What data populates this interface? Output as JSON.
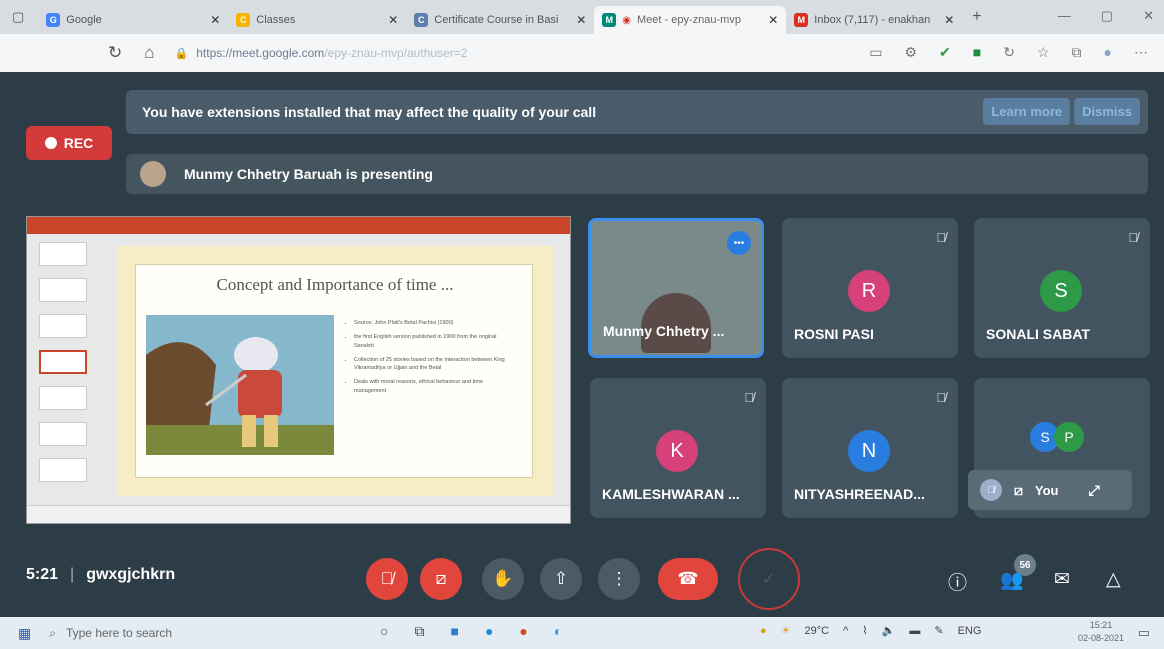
{
  "browser": {
    "tabs": [
      {
        "label": "Google",
        "favicon": "G",
        "color": "#4285f4"
      },
      {
        "label": "Classes",
        "favicon": "C",
        "color": "#f4b400"
      },
      {
        "label": "Certificate Course in Basi",
        "favicon": "C",
        "color": "#5f7da8"
      },
      {
        "label": "Meet - epy-znau-mvp",
        "favicon": "M",
        "color": "#00897b"
      },
      {
        "label": "Inbox (7,117) - enakhan",
        "favicon": "M",
        "color": "#d93025"
      }
    ],
    "url_host": "https://meet.google.com",
    "url_path": "/epy-znau-mvp/authuser=2"
  },
  "meet": {
    "rec_label": "REC",
    "extension_banner": "You have extensions installed that may affect the quality of your call",
    "learn_more": "Learn more",
    "dismiss": "Dismiss",
    "presenting_text": "Munmy Chhetry Baruah is presenting",
    "slide": {
      "title": "Concept and Importance of time ...",
      "bullets": [
        "Source: John Platt's Betal Pachisi (1900)",
        "the first English version published in 1900 from the original Sanskrit",
        "Collection of 25 stories based on the interaction between King Vikramaditya or Ujjain and the Betal",
        "Deals with moral reasons, ethical behaviour and time management"
      ]
    },
    "participants": [
      {
        "name": "Munmy Chhetry ...",
        "initial": "",
        "color": ""
      },
      {
        "name": "ROSNI PASI",
        "initial": "R",
        "color": "#d6417a"
      },
      {
        "name": "SONALI SABAT",
        "initial": "S",
        "color": "#2e9a48"
      },
      {
        "name": "KAMLESHWARAN ...",
        "initial": "K",
        "color": "#d6417a"
      },
      {
        "name": "NITYASHREENAD...",
        "initial": "N",
        "color": "#2a7de0"
      }
    ],
    "others_initials": [
      "S",
      "P"
    ],
    "you_label": "You",
    "time": "5:21",
    "meeting_code": "gwxgjchkrn",
    "participant_count": "56"
  },
  "taskbar": {
    "search_placeholder": "Type here to search",
    "temperature": "29°C",
    "language": "ENG",
    "clock_time": "15:21",
    "clock_date": "02-08-2021"
  }
}
